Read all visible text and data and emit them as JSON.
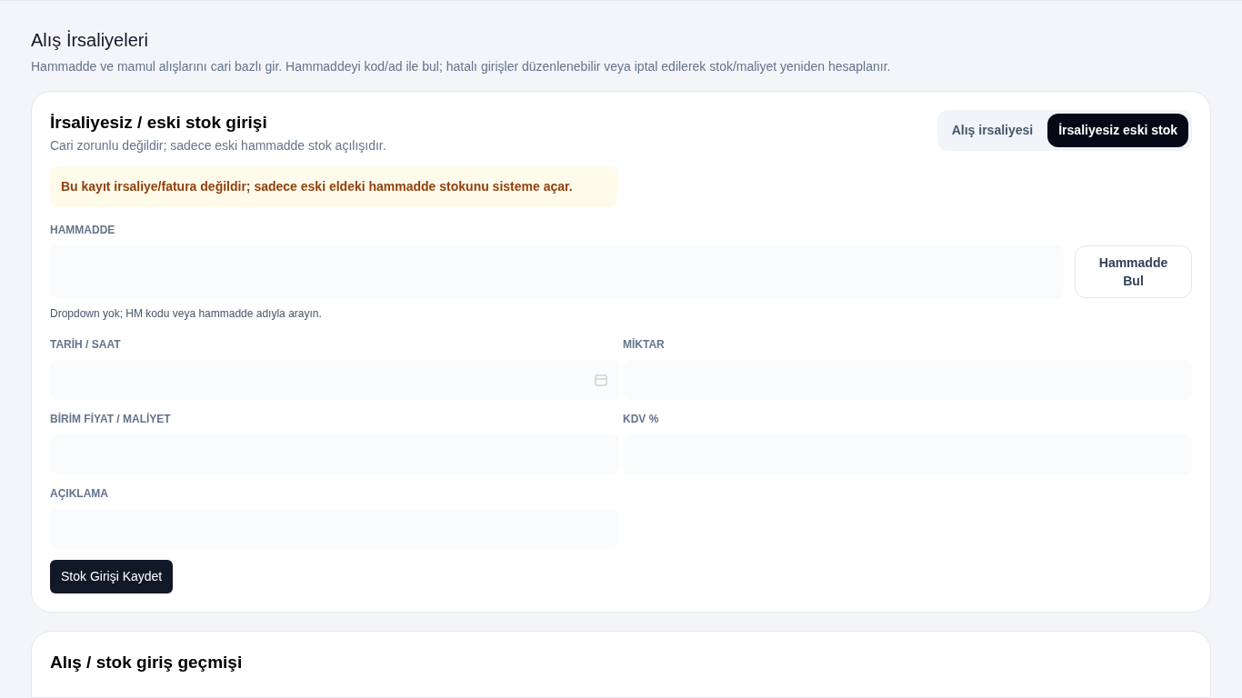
{
  "page": {
    "title": "Alış İrsaliyeleri",
    "subtitle": "Hammadde ve mamul alışlarını cari bazlı gir. Hammaddeyi kod/ad ile bul; hatalı girişler düzenlenebilir veya iptal edilerek stok/maliyet yeniden hesaplanır."
  },
  "entry_card": {
    "title": "İrsaliyesiz / eski stok girişi",
    "subtitle": "Cari zorunlu değildir; sadece eski hammadde stok açılışıdır.",
    "tabs": [
      {
        "label": "Alış irsaliyesi",
        "selected": false
      },
      {
        "label": "İrsaliyesiz eski stok",
        "selected": true
      }
    ],
    "notice": "Bu kayıt irsaliye/fatura değildir; sadece eski eldeki hammadde stokunu sisteme açar.",
    "material": {
      "label": "HAMMADDE",
      "button": "Hammadde Bul",
      "hint": "Dropdown yok; HM kodu veya hammadde adıyla arayın."
    },
    "fields": [
      {
        "label": "TARİH / SAAT",
        "kind": "datetime"
      },
      {
        "label": "MİKTAR",
        "kind": "text"
      },
      {
        "label": "BİRİM FİYAT / MALİYET",
        "kind": "text"
      },
      {
        "label": "KDV %",
        "kind": "text"
      },
      {
        "label": "AÇIKLAMA",
        "kind": "text"
      }
    ],
    "submit": "Stok Girişi Kaydet"
  },
  "history_card": {
    "title": "Alış / stok giriş geçmişi"
  }
}
